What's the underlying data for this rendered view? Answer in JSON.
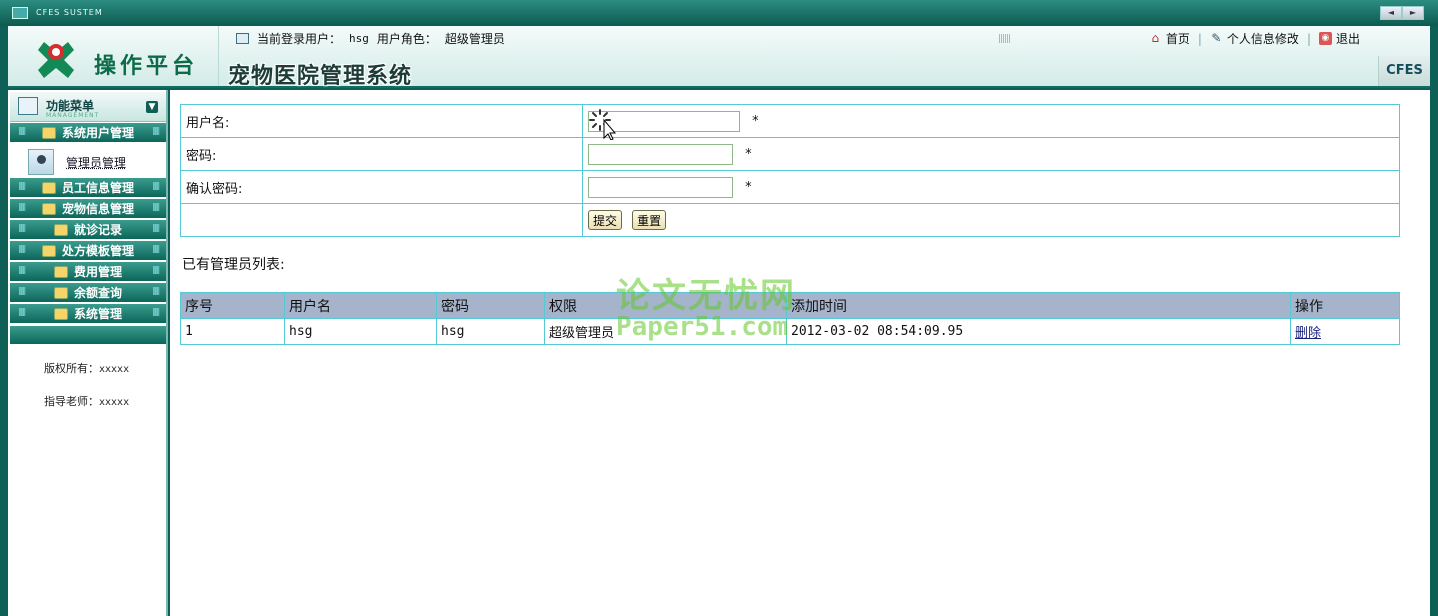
{
  "window": {
    "system_title": "CFES SUSTEM",
    "nav_prev": "◄",
    "nav_next": "►"
  },
  "header": {
    "platform_title": "操作平台",
    "app_title": "宠物医院管理系统",
    "current_user_label": "当前登录用户：",
    "current_user": "hsg",
    "role_label": "用户角色：",
    "role": "超级管理员",
    "links": {
      "home": "首页",
      "profile": "个人信息修改",
      "logout": "退出"
    },
    "brand": "CFES"
  },
  "sidebar": {
    "title": "功能菜单",
    "subtitle": "MANAGEMENT",
    "items": [
      {
        "label": "系统用户管理"
      },
      {
        "label": "员工信息管理"
      },
      {
        "label": "宠物信息管理"
      },
      {
        "label": "就诊记录"
      },
      {
        "label": "处方模板管理"
      },
      {
        "label": "费用管理"
      },
      {
        "label": "余额查询"
      },
      {
        "label": "系统管理"
      }
    ],
    "subitem": "管理员管理",
    "copyright_label": "版权所有：",
    "copyright_value": "xxxxx",
    "advisor_label": "指导老师：",
    "advisor_value": "xxxxx"
  },
  "form": {
    "username_label": "用户名:",
    "password_label": "密码:",
    "confirm_label": "确认密码:",
    "required_mark": "*",
    "username_value": "",
    "password_value": "",
    "confirm_value": "",
    "submit_label": "提交",
    "reset_label": "重置"
  },
  "list": {
    "title": "已有管理员列表:",
    "columns": [
      "序号",
      "用户名",
      "密码",
      "权限",
      "添加时间",
      "操作"
    ],
    "rows": [
      {
        "index": "1",
        "username": "hsg",
        "password": "hsg",
        "role": "超级管理员",
        "added": "2012-03-02 08:54:09.95",
        "action": "删除"
      }
    ]
  },
  "watermark": {
    "line1": "论文无忧网",
    "line2": "Paper51.com"
  }
}
